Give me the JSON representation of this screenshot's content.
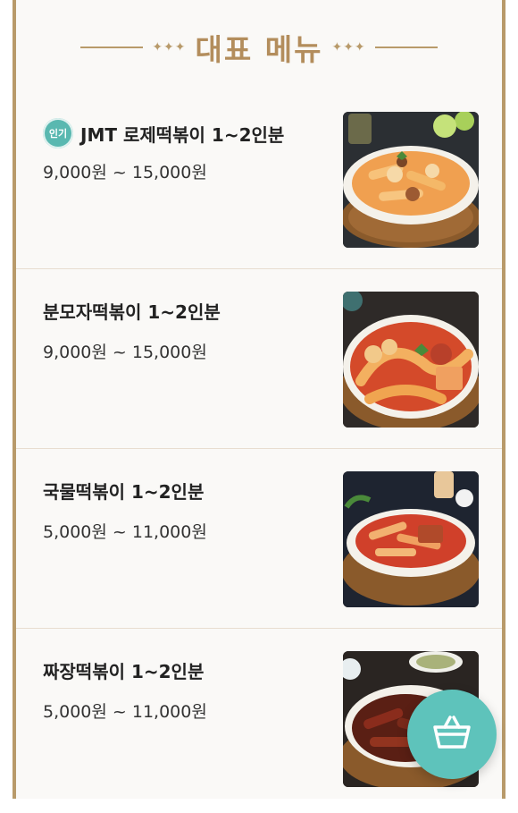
{
  "header": {
    "title": "대표 메뉴",
    "left_ornament": "✦✦✦",
    "right_ornament": "✦✦✦"
  },
  "menu": {
    "items": [
      {
        "badge": "인기",
        "name": "JMT 로제떡볶이 1~2인분",
        "price": "9,000원 ~ 15,000원",
        "photo_icon": "rose-tteokbokki-photo"
      },
      {
        "badge": "",
        "name": "분모자떡볶이 1~2인분",
        "price": "9,000원 ~ 15,000원",
        "photo_icon": "bunmoja-tteokbokki-photo"
      },
      {
        "badge": "",
        "name": "국물떡볶이 1~2인분",
        "price": "5,000원 ~ 11,000원",
        "photo_icon": "soup-tteokbokki-photo"
      },
      {
        "badge": "",
        "name": "짜장떡볶이 1~2인분",
        "price": "5,000원 ~ 11,000원",
        "photo_icon": "jjajang-tteokbokki-photo"
      }
    ]
  },
  "cart": {
    "icon": "basket-icon"
  },
  "colors": {
    "accent_gold": "#b38d5c",
    "badge_teal": "#59b8b0",
    "fab_teal": "#5ec3bb"
  }
}
